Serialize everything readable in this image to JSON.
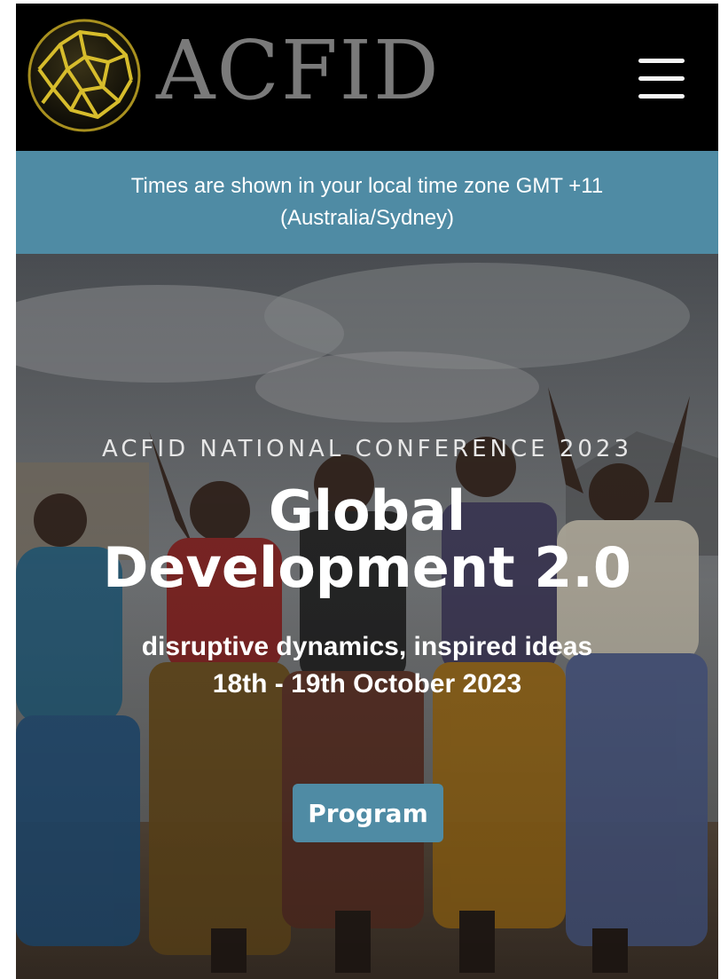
{
  "header": {
    "brand": "ACFID",
    "logo_icon": "acfid-globe-logo-icon",
    "menu_icon": "hamburger-menu-icon"
  },
  "timezone_banner": {
    "line1": "Times are shown in your local time zone GMT +11",
    "line2": "(Australia/Sydney)"
  },
  "hero": {
    "eyebrow": "ACFID NATIONAL CONFERENCE 2023",
    "title_line1": "Global",
    "title_line2": "Development 2.0",
    "subtitle": "disruptive dynamics, inspired ideas",
    "date": "18th - 19th October 2023",
    "cta_label": "Program",
    "photo_icon": "dancing-women-photo"
  },
  "colors": {
    "accent": "#4f8ba4",
    "header_bg": "#000000",
    "logo_gold": "#c9b02a",
    "brand_gray": "#7a7a7a"
  }
}
